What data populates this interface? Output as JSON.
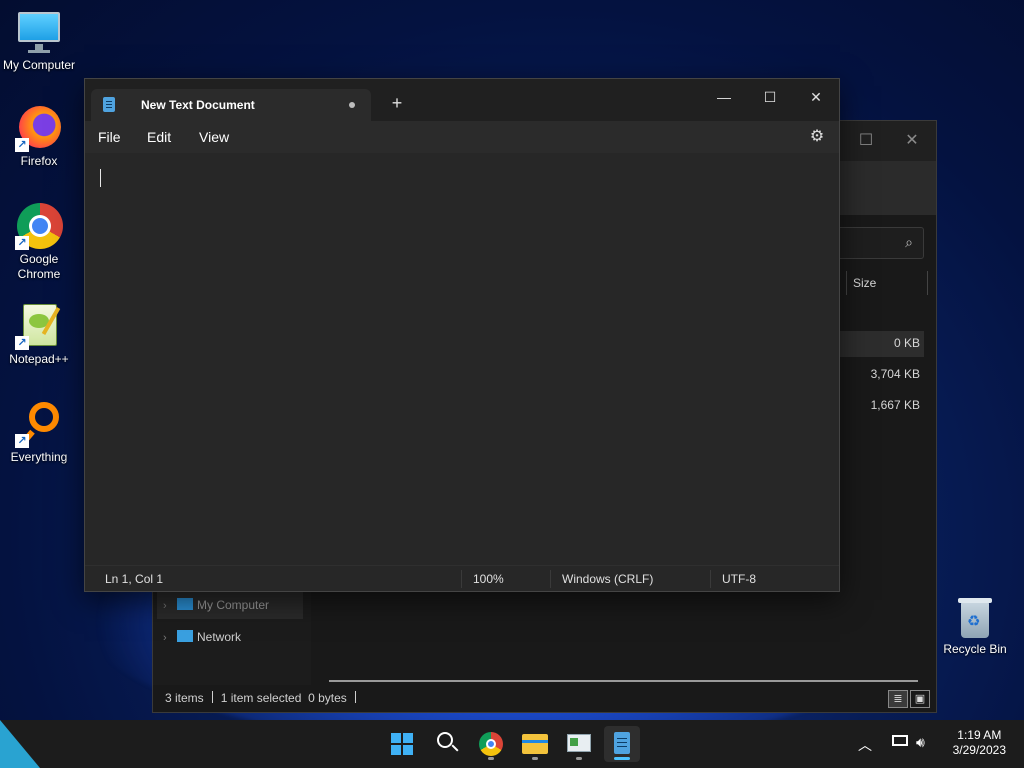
{
  "desktop": {
    "icons": [
      {
        "label": "My Computer",
        "icon": "monitor-icon"
      },
      {
        "label": "Firefox",
        "icon": "firefox-icon"
      },
      {
        "label": "Google Chrome",
        "icon": "chrome-icon"
      },
      {
        "label": "Notepad++",
        "icon": "notepadpp-icon"
      },
      {
        "label": "Everything",
        "icon": "everything-search-icon"
      }
    ],
    "recycle_bin": {
      "label": "Recycle Bin",
      "icon": "recycle-bin-icon"
    }
  },
  "notepad": {
    "tab_title": "New Text Document",
    "new_tab_symbol": "+",
    "window_controls": {
      "minimize": "—",
      "maximize": "☐",
      "close": "✕"
    },
    "menu": [
      "File",
      "Edit",
      "View"
    ],
    "settings_icon": "gear-icon",
    "content": "",
    "status": {
      "position": "Ln 1, Col 1",
      "zoom": "100%",
      "line_ending": "Windows (CRLF)",
      "encoding": "UTF-8"
    }
  },
  "explorer": {
    "column_size": "Size",
    "sizes": [
      "0 KB",
      "3,704 KB",
      "1,667 KB"
    ],
    "nav": [
      {
        "label": "My Computer",
        "icon": "monitor-icon"
      },
      {
        "label": "Network",
        "icon": "network-icon"
      }
    ],
    "status": {
      "items": "3 items",
      "selected": "1 item selected",
      "bytes": "0 bytes"
    }
  },
  "taskbar": {
    "apps": [
      "start-icon",
      "search-icon",
      "chrome-icon",
      "file-explorer-icon",
      "control-panel-icon",
      "notepad-icon"
    ],
    "clock": {
      "time": "1:19 AM",
      "date": "3/29/2023"
    },
    "tray_icons": [
      "chevron-up-icon",
      "network-icon",
      "volume-icon"
    ]
  },
  "colors": {
    "accent": "#4cc2ff",
    "window_bg": "#272727",
    "titlebar_bg": "#202020"
  }
}
